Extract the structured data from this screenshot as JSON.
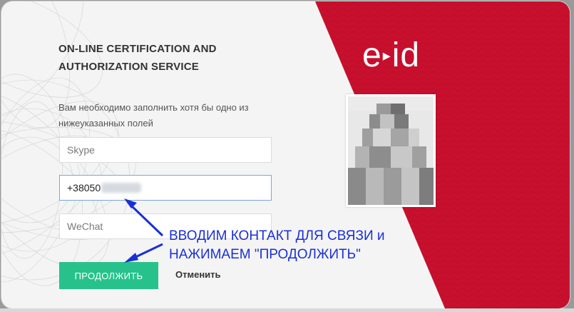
{
  "card": {
    "title": "ON-LINE CERTIFICATION AND AUTHORIZATION SERVICE",
    "instructions": "Вам необходимо заполнить хотя бы одно из нижеуказанных полей",
    "fields": {
      "skype_placeholder": "Skype",
      "phone_value": "+38050",
      "wechat_placeholder": "WeChat"
    },
    "buttons": {
      "continue_label": "ПРОДОЛЖИТЬ",
      "cancel_label": "Отменить"
    },
    "logo_left": "e",
    "logo_mark": "▸",
    "logo_right": "id"
  },
  "annotation": {
    "line1": "ВВОДИМ КОНТАКТ ДЛЯ СВЯЗИ и",
    "line2": "НАЖИМАЕМ \"ПРОДОЛЖИТЬ\""
  },
  "colors": {
    "accent_green": "#27c28c",
    "brand_red": "#c8102e",
    "annotation_blue": "#1a2fd6"
  },
  "icons": [
    "arrow-up-icon",
    "arrow-down-icon"
  ]
}
